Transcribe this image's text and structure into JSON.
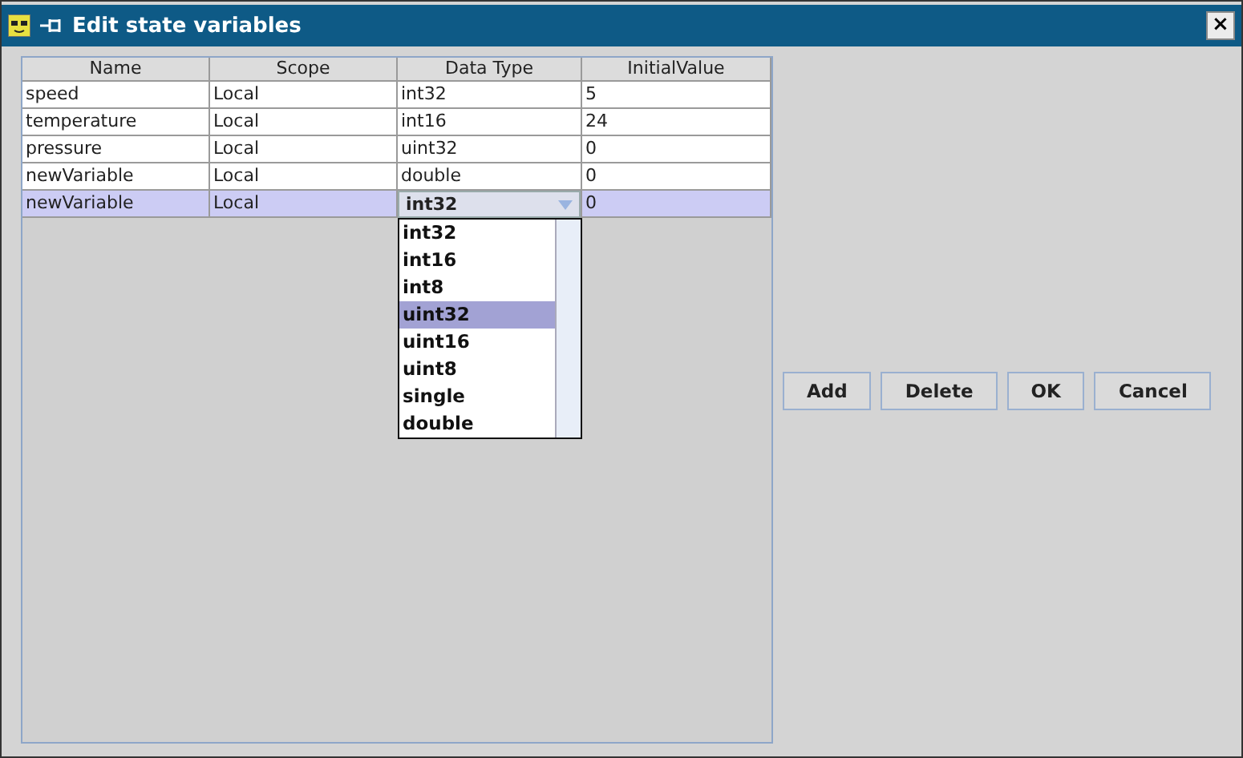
{
  "window": {
    "title": "Edit state variables",
    "close": "×"
  },
  "table": {
    "columns": [
      "Name",
      "Scope",
      "Data Type",
      "InitialValue"
    ],
    "rows": [
      {
        "cells": [
          "speed",
          "Local",
          "int32",
          "5"
        ],
        "selected": false
      },
      {
        "cells": [
          "temperature",
          "Local",
          "int16",
          "24"
        ],
        "selected": false
      },
      {
        "cells": [
          "pressure",
          "Local",
          "uint32",
          "0"
        ],
        "selected": false
      },
      {
        "cells": [
          "newVariable",
          "Local",
          "double",
          "0"
        ],
        "selected": false
      },
      {
        "cells": [
          "newVariable",
          "Local",
          "int32",
          "0"
        ],
        "selected": true
      }
    ]
  },
  "dropdown": {
    "options": [
      {
        "label": "int32",
        "selected": false
      },
      {
        "label": "int16",
        "selected": false
      },
      {
        "label": "int8",
        "selected": false
      },
      {
        "label": "uint32",
        "selected": true
      },
      {
        "label": "uint16",
        "selected": false
      },
      {
        "label": "uint8",
        "selected": false
      },
      {
        "label": "single",
        "selected": false
      },
      {
        "label": "double",
        "selected": false
      }
    ]
  },
  "buttons": [
    "Add",
    "Delete",
    "OK",
    "Cancel"
  ]
}
